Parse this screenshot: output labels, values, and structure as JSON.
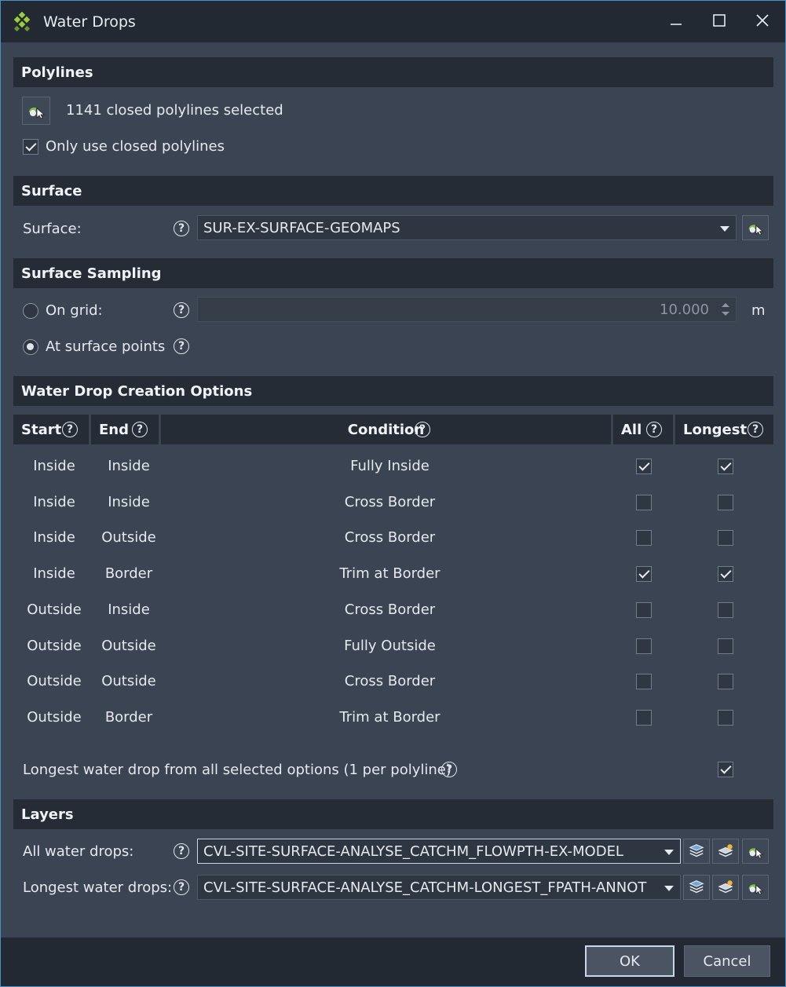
{
  "window": {
    "title": "Water Drops"
  },
  "polylines": {
    "header": "Polylines",
    "selected_text": "1141 closed polylines selected",
    "only_closed_label": "Only use closed polylines",
    "only_closed_checked": true
  },
  "surface": {
    "header": "Surface",
    "label": "Surface:",
    "value": "SUR-EX-SURFACE-GEOMAPS"
  },
  "sampling": {
    "header": "Surface Sampling",
    "on_grid_label": "On grid:",
    "grid_value": "10.000",
    "unit": "m",
    "at_points_label": "At surface points",
    "selected": "at_points"
  },
  "options": {
    "header": "Water Drop Creation Options",
    "columns": {
      "start": "Start",
      "end": "End",
      "condition": "Condition",
      "all": "All",
      "longest": "Longest"
    },
    "rows": [
      {
        "start": "Inside",
        "end": "Inside",
        "condition": "Fully Inside",
        "all": true,
        "longest": true
      },
      {
        "start": "Inside",
        "end": "Inside",
        "condition": "Cross Border",
        "all": false,
        "longest": false
      },
      {
        "start": "Inside",
        "end": "Outside",
        "condition": "Cross Border",
        "all": false,
        "longest": false
      },
      {
        "start": "Inside",
        "end": "Border",
        "condition": "Trim at Border",
        "all": true,
        "longest": true
      },
      {
        "start": "Outside",
        "end": "Inside",
        "condition": "Cross Border",
        "all": false,
        "longest": false
      },
      {
        "start": "Outside",
        "end": "Outside",
        "condition": "Fully Outside",
        "all": false,
        "longest": false
      },
      {
        "start": "Outside",
        "end": "Outside",
        "condition": "Cross Border",
        "all": false,
        "longest": false
      },
      {
        "start": "Outside",
        "end": "Border",
        "condition": "Trim at Border",
        "all": false,
        "longest": false
      }
    ],
    "longest_all_label": "Longest water drop from all selected options (1 per polyline)",
    "longest_all_checked": true
  },
  "layers": {
    "header": "Layers",
    "all_label": "All water drops:",
    "all_value": "CVL-SITE-SURFACE-ANALYSE_CATCHM_FLOWPTH-EX-MODEL",
    "longest_label": "Longest water drops:",
    "longest_value": "CVL-SITE-SURFACE-ANALYSE_CATCHM-LONGEST_FPATH-ANNOT"
  },
  "buttons": {
    "ok": "OK",
    "cancel": "Cancel"
  },
  "icons": {
    "app": "water-drops-app-icon",
    "pick": "pick-from-drawing-icon",
    "layer": "layer-stack-icon",
    "new_layer": "new-layer-icon"
  },
  "colors": {
    "accent_border": "#4a90c8",
    "background": "#3b4453",
    "header": "#252c36"
  }
}
